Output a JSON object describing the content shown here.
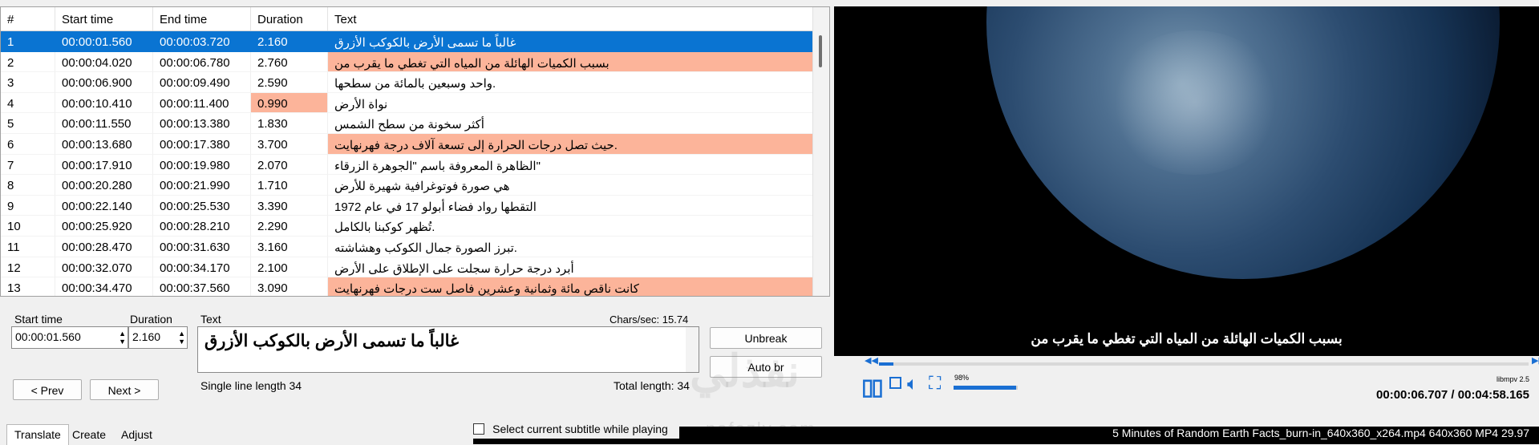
{
  "grid": {
    "columns": [
      "#",
      "Start time",
      "End time",
      "Duration",
      "Text"
    ],
    "rows": [
      {
        "num": "1",
        "start": "00:00:01.560",
        "end": "00:00:03.720",
        "dur": "2.160",
        "text": "غالباً ما تسمى الأرض بالكوكب الأزرق",
        "selected": true,
        "warn_dur": false,
        "warn_text": false
      },
      {
        "num": "2",
        "start": "00:00:04.020",
        "end": "00:00:06.780",
        "dur": "2.760",
        "text": "بسبب الكميات الهائلة من المياه التي تغطي ما يقرب من",
        "selected": false,
        "warn_dur": false,
        "warn_text": true
      },
      {
        "num": "3",
        "start": "00:00:06.900",
        "end": "00:00:09.490",
        "dur": "2.590",
        "text": ".واحد وسبعين بالمائة من سطحها",
        "selected": false,
        "warn_dur": false,
        "warn_text": false
      },
      {
        "num": "4",
        "start": "00:00:10.410",
        "end": "00:00:11.400",
        "dur": "0.990",
        "text": "نواة الأرض",
        "selected": false,
        "warn_dur": true,
        "warn_text": false
      },
      {
        "num": "5",
        "start": "00:00:11.550",
        "end": "00:00:13.380",
        "dur": "1.830",
        "text": "أكثر سخونة من سطح الشمس",
        "selected": false,
        "warn_dur": false,
        "warn_text": false
      },
      {
        "num": "6",
        "start": "00:00:13.680",
        "end": "00:00:17.380",
        "dur": "3.700",
        "text": ".حيث تصل درجات الحرارة إلى تسعة آلاف درجة فهرنهايت",
        "selected": false,
        "warn_dur": false,
        "warn_text": true
      },
      {
        "num": "7",
        "start": "00:00:17.910",
        "end": "00:00:19.980",
        "dur": "2.070",
        "text": "\"الظاهرة المعروفة باسم \"الجوهرة الزرقاء",
        "selected": false,
        "warn_dur": false,
        "warn_text": false
      },
      {
        "num": "8",
        "start": "00:00:20.280",
        "end": "00:00:21.990",
        "dur": "1.710",
        "text": "هي صورة فوتوغرافية شهيرة للأرض",
        "selected": false,
        "warn_dur": false,
        "warn_text": false
      },
      {
        "num": "9",
        "start": "00:00:22.140",
        "end": "00:00:25.530",
        "dur": "3.390",
        "text": "التقطها رواد فضاء أبولو 17 في عام 1972",
        "selected": false,
        "warn_dur": false,
        "warn_text": false
      },
      {
        "num": "10",
        "start": "00:00:25.920",
        "end": "00:00:28.210",
        "dur": "2.290",
        "text": ".تُظهر كوكبنا بالكامل",
        "selected": false,
        "warn_dur": false,
        "warn_text": false
      },
      {
        "num": "11",
        "start": "00:00:28.470",
        "end": "00:00:31.630",
        "dur": "3.160",
        "text": ".تبرز الصورة جمال الكوكب وهشاشته",
        "selected": false,
        "warn_dur": false,
        "warn_text": false
      },
      {
        "num": "12",
        "start": "00:00:32.070",
        "end": "00:00:34.170",
        "dur": "2.100",
        "text": "أبرد درجة حرارة سجلت على الإطلاق على الأرض",
        "selected": false,
        "warn_dur": false,
        "warn_text": false
      },
      {
        "num": "13",
        "start": "00:00:34.470",
        "end": "00:00:37.560",
        "dur": "3.090",
        "text": "كانت ناقص مائة وثمانية وعشرين فاصل ست درجات فهرنهايت",
        "selected": false,
        "warn_dur": false,
        "warn_text": true
      }
    ]
  },
  "editor": {
    "start_label": "Start time",
    "start_value": "00:00:01.560",
    "duration_label": "Duration",
    "duration_value": "2.160",
    "text_label": "Text",
    "chars_sec": "Chars/sec: 15.74",
    "text_value": "غالباً ما تسمى الأرض بالكوكب الأزرق",
    "single_line_length": "Single line length 34",
    "total_length": "Total length: 34",
    "unbreak": "Unbreak",
    "auto_br": "Auto br",
    "prev": "< Prev",
    "next": "Next >"
  },
  "video": {
    "subtitle": "بسبب الكميات الهائلة من المياه التي تغطي ما يقرب من",
    "engine": "libmpv 2.5",
    "volume": "98%",
    "volume_level": 0.98,
    "time": "00:00:06.707 / 00:04:58.165",
    "progress": 0.022
  },
  "bottom": {
    "tabs": [
      "Translate",
      "Create",
      "Adjust"
    ],
    "checkbox_label": "Select current subtitle while playing",
    "file_info": "5 Minutes of Random Earth Facts_burn-in_640x360_x264.mp4 640x360 MP4 29.97"
  },
  "watermark": {
    "main": "نفذلي",
    "latin": "nafezly.com"
  },
  "colors": {
    "selection": "#0a74d2",
    "warning": "#fcb49a",
    "accent": "#1a6fd3"
  }
}
